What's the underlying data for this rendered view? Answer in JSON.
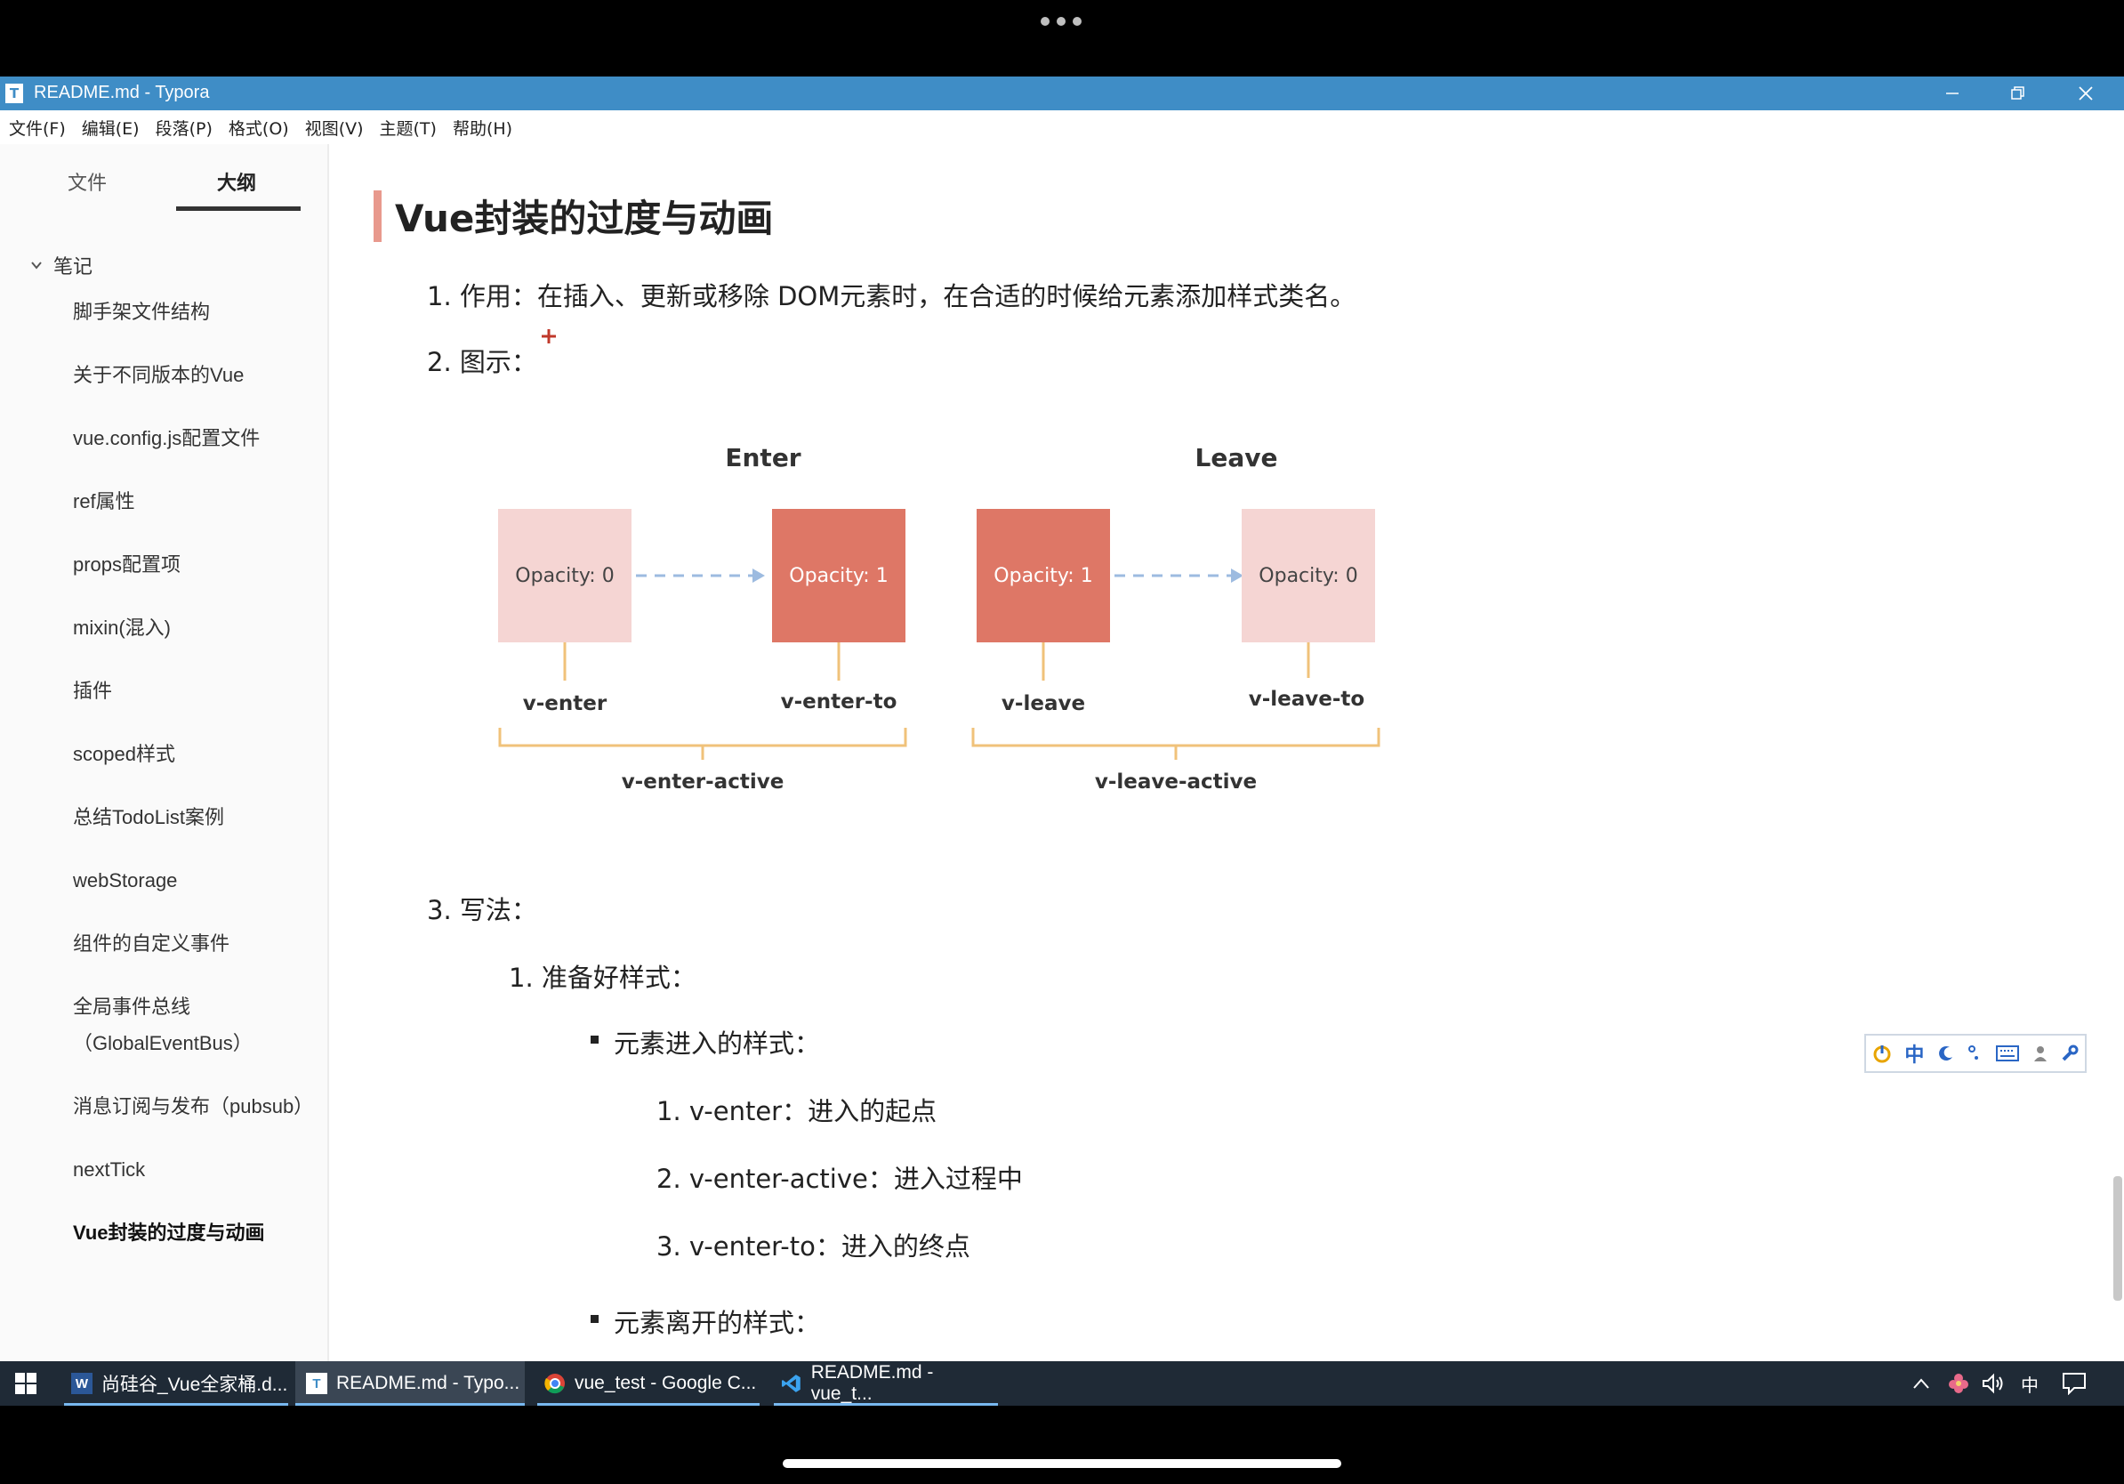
{
  "window": {
    "title": "README.md - Typora"
  },
  "menu": [
    "文件(F)",
    "编辑(E)",
    "段落(P)",
    "格式(O)",
    "视图(V)",
    "主题(T)",
    "帮助(H)"
  ],
  "sidebar": {
    "tab_files": "文件",
    "tab_outline": "大纲",
    "outline_root": "笔记",
    "items": [
      "脚手架文件结构",
      "关于不同版本的Vue",
      "vue.config.js配置文件",
      "ref属性",
      "props配置项",
      "mixin(混入)",
      "插件",
      "scoped样式",
      "总结TodoList案例",
      "webStorage",
      "组件的自定义事件",
      "全局事件总线（GlobalEventBus）",
      "消息订阅与发布（pubsub）",
      "nextTick",
      "Vue封装的过度与动画"
    ]
  },
  "doc": {
    "heading": "Vue封装的过度与动画",
    "item1": "1. 作用：在插入、更新或移除 DOM元素时，在合适的时候给元素添加样式类名。",
    "item2": "2. 图示：",
    "item3": "3. 写法：",
    "sub1": "1. 准备好样式：",
    "bullet_enter": "元素进入的样式：",
    "enter_list": [
      "1. v-enter：进入的起点",
      "2. v-enter-active：进入过程中",
      "3. v-enter-to：进入的终点"
    ],
    "bullet_leave": "元素离开的样式："
  },
  "diagram": {
    "enter_title": "Enter",
    "leave_title": "Leave",
    "box_opacity0": "Opacity: 0",
    "box_opacity1": "Opacity: 1",
    "v_enter": "v-enter",
    "v_enter_to": "v-enter-to",
    "v_leave": "v-leave",
    "v_leave_to": "v-leave-to",
    "v_enter_active": "v-enter-active",
    "v_leave_active": "v-leave-active",
    "colors": {
      "light": "#f5d5d3",
      "dark": "#de7766",
      "arrow": "#9dbbe0",
      "bracket": "#f0c27a"
    }
  },
  "ime": {
    "mode": "中"
  },
  "taskbar": {
    "items": [
      "尚硅谷_Vue全家桶.d...",
      "README.md - Typo...",
      "vue_test - Google C...",
      "README.md - vue_t..."
    ],
    "lang": "中"
  }
}
